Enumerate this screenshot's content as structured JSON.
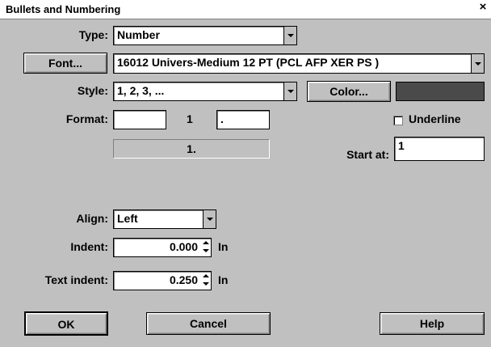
{
  "window": {
    "title": "Bullets and Numbering",
    "close_glyph": "×"
  },
  "type": {
    "label": "Type:",
    "value": "Number"
  },
  "font": {
    "button_label": "Font...",
    "value": "16012  Univers-Medium 12 PT (PCL AFP XER PS )"
  },
  "style": {
    "label": "Style:",
    "value": "1, 2, 3, ..."
  },
  "color": {
    "button_label": "Color...",
    "swatch_color": "#4a4a4a"
  },
  "format": {
    "label": "Format:",
    "prefix_value": "",
    "number_token": "1",
    "suffix_value": ".",
    "preview_value": "1."
  },
  "underline": {
    "label": "Underline",
    "checked": false
  },
  "start_at": {
    "label": "Start at:",
    "value": "1"
  },
  "align": {
    "label": "Align:",
    "value": "Left"
  },
  "indent": {
    "label": "Indent:",
    "value": "0.000",
    "unit": "In"
  },
  "text_indent": {
    "label": "Text indent:",
    "value": "0.250",
    "unit": "In"
  },
  "buttons": {
    "ok": "OK",
    "cancel": "Cancel",
    "help": "Help"
  }
}
